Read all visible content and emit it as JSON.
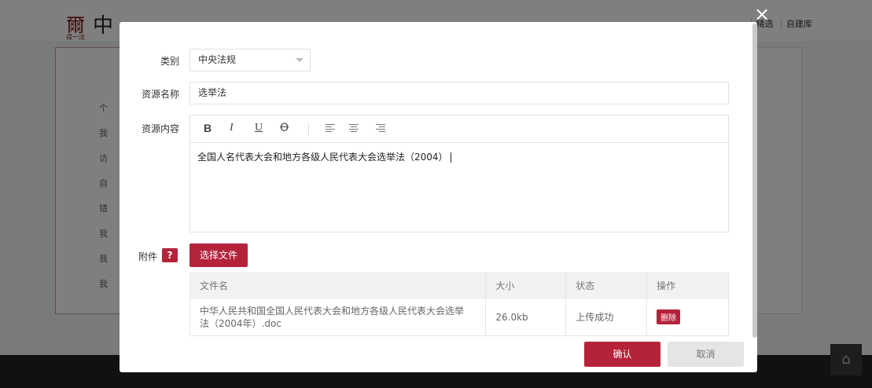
{
  "background": {
    "logo_mark": "爾",
    "logo_sub": "得一法",
    "logo_text": "中",
    "nav": [
      "精选",
      "自建库"
    ],
    "sidebar_items": [
      "个",
      "我",
      "访",
      "自",
      "错",
      "我",
      "我",
      "我"
    ]
  },
  "dialog": {
    "fields": {
      "category_label": "类别",
      "category_value": "中央法规",
      "name_label": "资源名称",
      "name_value": "选举法",
      "content_label": "资源内容",
      "content_value": "全国人名代表大会和地方各级人民代表大会选举法（2004）",
      "attachment_label": "附件"
    },
    "toolbar": {
      "bold": "B",
      "italic": "I",
      "underline": "U",
      "strike": "Ꝋ"
    },
    "help_label": "?",
    "choose_file_label": "选择文件",
    "table": {
      "headers": [
        "文件名",
        "大小",
        "状态",
        "操作"
      ],
      "rows": [
        {
          "filename": "中华人民共和国全国人民代表大会和地方各级人民代表大会选举法（2004年）.doc",
          "size": "26.0kb",
          "status": "上传成功",
          "action": "删除"
        }
      ]
    },
    "confirm_label": "确认",
    "cancel_label": "取消"
  },
  "colors": {
    "accent": "#b5233b",
    "success": "#4cae4c"
  }
}
